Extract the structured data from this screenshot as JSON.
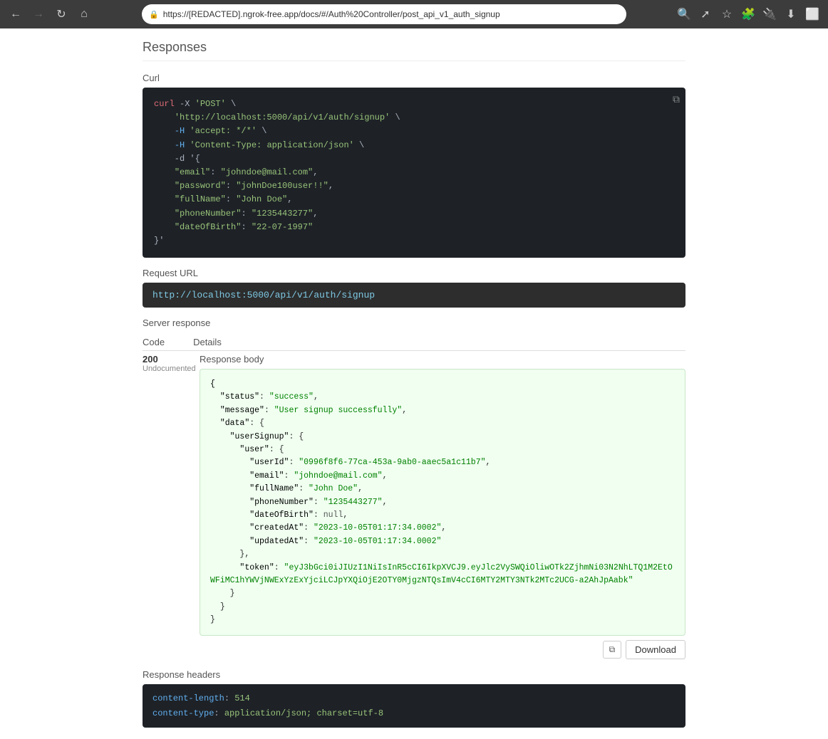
{
  "browser": {
    "address": "https://[REDACTED].ngrok-free.app/docs/#/Auth%20Controller/post_api_v1_auth_signup",
    "nav": {
      "back_label": "←",
      "forward_label": "→",
      "reload_label": "↻",
      "home_label": "⌂"
    }
  },
  "page": {
    "responses_title": "Responses",
    "curl_label": "Curl",
    "curl_code": "curl -X 'POST' \\\n    'http://localhost:5000/api/v1/auth/signup' \\\n    -H 'accept: */*' \\\n    -H 'Content-Type: application/json' \\\n    -d '{\n    \"email\": \"johndoe@mail.com\",\n    \"password\": \"johnDoe100user!!\",\n    \"fullName\": \"John Doe\",\n    \"phoneNumber\": \"1235443277\",\n    \"dateOfBirth\": \"22-07-1997\"\n}'",
    "request_url_label": "Request URL",
    "request_url_value": "http://localhost:5000/api/v1/auth/signup",
    "server_response_label": "Server response",
    "table_headers": {
      "code": "Code",
      "details": "Details"
    },
    "response_code": "200",
    "response_code_sub": "Undocumented",
    "response_body_label": "Response body",
    "response_body": "{\n  \"status\": \"success\",\n  \"message\": \"User signup successfully\",\n  \"data\": {\n    \"userSignup\": {\n      \"user\": {\n        \"userId\": \"0996f8f6-77ca-453a-9ab0-aaec5a1c11b7\",\n        \"email\": \"johndoe@mail.com\",\n        \"fullName\": \"John Doe\",\n        \"phoneNumber\": \"1235443277\",\n        \"dateOfBirth\": null,\n        \"createdAt\": \"2023-10-05T01:17:34.0002\",\n        \"updatedAt\": \"2023-10-05T01:17:34.0002\"\n      },\n      \"token\": \"eyJ3bGci0iJIUzI1NiIsInR5cCI6IkpXVCJ9.eyJlc2VySWQiOliwOTk2ZjhmNi03N2NhLTQ1M2EtOWFiMC1hYWVjNWExYzExYjciLCJpYXQiOjE2OTY0MjgzNTQsImV4cCI6MTY2MTY3NTk2MTc2UCG-a2AhJpAabk\"\n    }\n  }\n}",
    "response_body_actions": {
      "copy_label": "⧉",
      "download_label": "Download"
    },
    "response_headers_label": "Response headers",
    "response_headers": [
      {
        "key": "content-length",
        "value": "514"
      },
      {
        "key": "content-type",
        "value": "application/json; charset=utf-8"
      }
    ]
  }
}
